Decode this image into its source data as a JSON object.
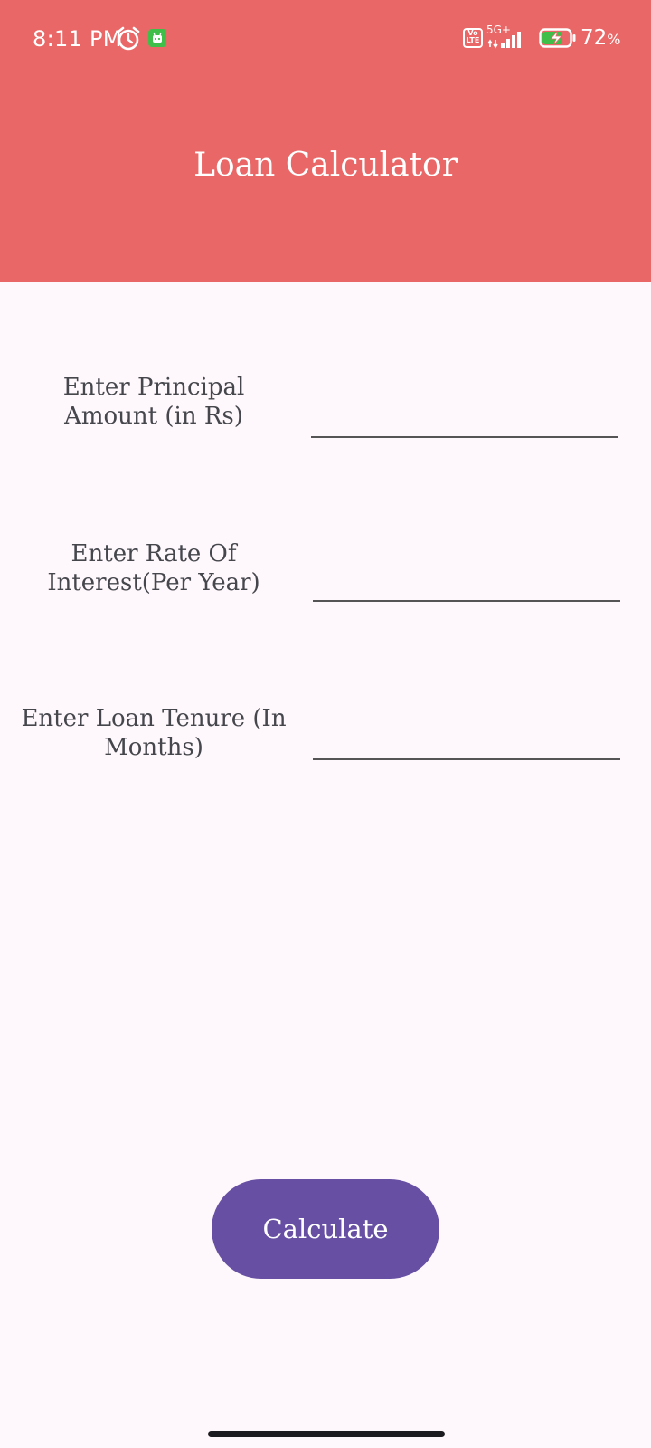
{
  "status_bar": {
    "time": "8:11 PM",
    "volte_top": "Vo",
    "volte_bottom": "LTE",
    "network_type": "5G+",
    "battery_percent": "72",
    "battery_unit": "%",
    "icons": [
      "alarm-icon",
      "app-notification-icon",
      "volte-icon",
      "signal-icon",
      "battery-charging-icon"
    ]
  },
  "header": {
    "title": "Loan Calculator",
    "background_color": "#ea6767"
  },
  "form": {
    "principal": {
      "label_line1": "Enter Principal",
      "label_line2": "Amount (in Rs)",
      "value": "",
      "placeholder": ""
    },
    "rate": {
      "label_line1": "Enter Rate Of",
      "label_line2": "Interest(Per Year)",
      "value": "",
      "placeholder": ""
    },
    "tenure": {
      "label_line1": "Enter Loan Tenure (In",
      "label_line2": "Months)",
      "value": "",
      "placeholder": ""
    }
  },
  "actions": {
    "calculate_label": "Calculate",
    "button_color": "#6750a4"
  }
}
